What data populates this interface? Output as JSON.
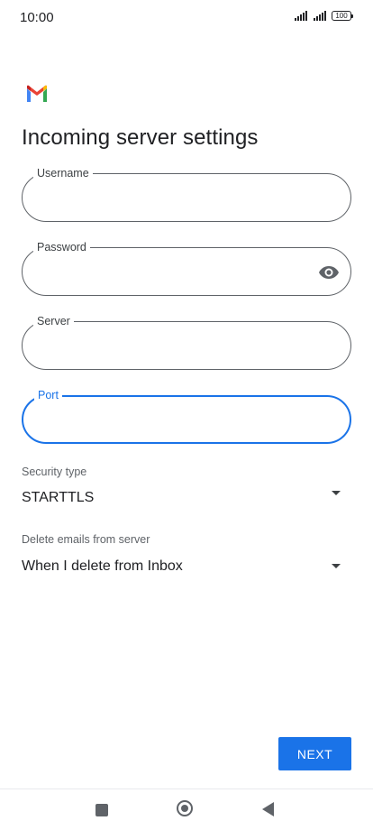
{
  "status_bar": {
    "time": "10:00",
    "battery": "100"
  },
  "app": {
    "logo_icon": "gmail-logo-icon",
    "title": "Incoming server settings"
  },
  "form": {
    "username": {
      "label": "Username",
      "value": ""
    },
    "password": {
      "label": "Password",
      "value": "",
      "toggle_icon": "eye-icon"
    },
    "server": {
      "label": "Server",
      "value": ""
    },
    "port": {
      "label": "Port",
      "value": "",
      "focused": true
    }
  },
  "security_type": {
    "label": "Security type",
    "value": "STARTTLS"
  },
  "delete_emails": {
    "label": "Delete emails from server",
    "value": "When I delete from Inbox"
  },
  "actions": {
    "next_label": "NEXT"
  },
  "colors": {
    "accent": "#1a73e8",
    "outline": "#5f6368",
    "text": "#202124"
  }
}
